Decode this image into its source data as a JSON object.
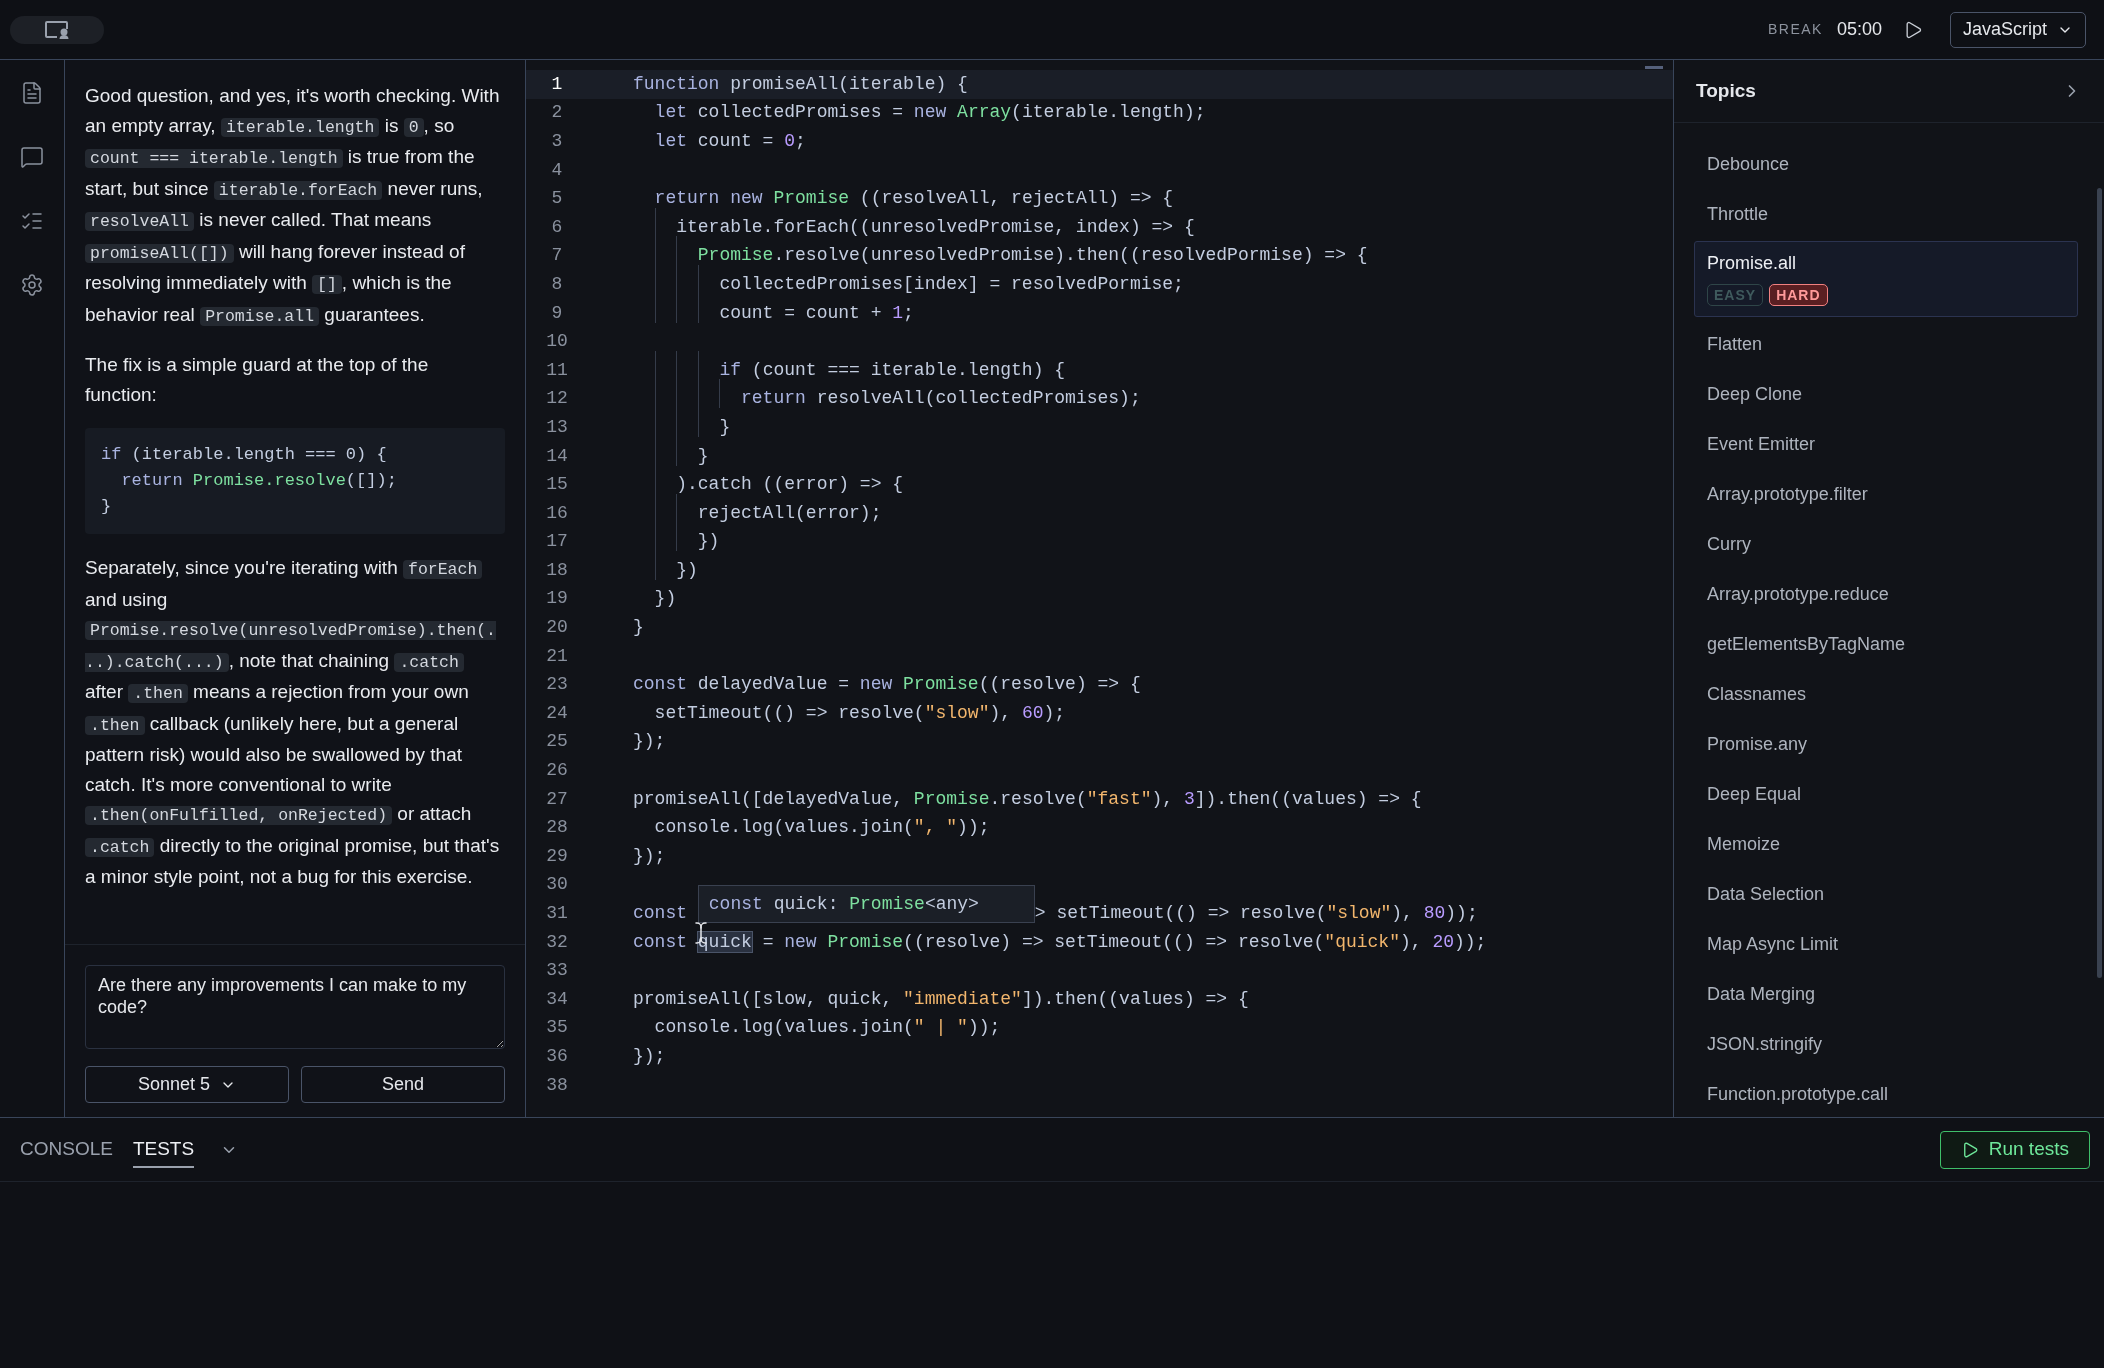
{
  "top_bar": {
    "break_label": "BREAK",
    "timer": "05:00",
    "language": "JavaScript"
  },
  "rail": [
    {
      "kind": "document"
    },
    {
      "kind": "chat"
    },
    {
      "kind": "checklist"
    },
    {
      "kind": "settings"
    }
  ],
  "chat": {
    "blocks": [
      {
        "kind": "paragraph",
        "segments": [
          {
            "kind": "text",
            "text": "Good question, and yes, it's worth checking. With an empty array, "
          },
          {
            "kind": "code",
            "text": "iterable.length"
          },
          {
            "kind": "text",
            "text": " is "
          },
          {
            "kind": "code",
            "text": "0"
          },
          {
            "kind": "text",
            "text": ", so "
          },
          {
            "kind": "code",
            "text": "count === iterable.length"
          },
          {
            "kind": "text",
            "text": " is true from the start, but since "
          },
          {
            "kind": "code",
            "text": "iterable.forEach"
          },
          {
            "kind": "text",
            "text": " never runs, "
          },
          {
            "kind": "code",
            "text": "resolveAll"
          },
          {
            "kind": "text",
            "text": " is never called. That means "
          },
          {
            "kind": "code",
            "text": "promiseAll([])"
          },
          {
            "kind": "text",
            "text": " will hang forever instead of resolving immediately with "
          },
          {
            "kind": "code",
            "text": "[]"
          },
          {
            "kind": "text",
            "text": ", which is the behavior real "
          },
          {
            "kind": "code",
            "text": "Promise.all"
          },
          {
            "kind": "text",
            "text": " guarantees."
          }
        ]
      },
      {
        "kind": "paragraph",
        "segments": [
          {
            "kind": "text",
            "text": "The fix is a simple guard at the top of the function:"
          }
        ]
      },
      {
        "kind": "code_block",
        "lines": [
          [
            {
              "kind": "k",
              "text": "if "
            },
            {
              "kind": "v",
              "text": "(iterable.length === 0) {"
            }
          ],
          [
            {
              "kind": "k",
              "text": "  return "
            },
            {
              "kind": "c",
              "text": "Promise.resolve"
            },
            {
              "kind": "v",
              "text": "([]);"
            }
          ],
          [
            {
              "kind": "v",
              "text": "}"
            }
          ]
        ]
      },
      {
        "kind": "paragraph",
        "segments": [
          {
            "kind": "text",
            "text": "Separately, since you're iterating with "
          },
          {
            "kind": "code",
            "text": "forEach"
          },
          {
            "kind": "text",
            "text": " and using "
          },
          {
            "kind": "code",
            "text": "Promise.resolve(unresolvedPromise).then(...).catch(...)"
          },
          {
            "kind": "text",
            "text": ", note that chaining "
          },
          {
            "kind": "code",
            "text": ".catch"
          },
          {
            "kind": "text",
            "text": " after "
          },
          {
            "kind": "code",
            "text": ".then"
          },
          {
            "kind": "text",
            "text": " means a rejection from your own "
          },
          {
            "kind": "code",
            "text": ".then"
          },
          {
            "kind": "text",
            "text": " callback (unlikely here, but a general pattern risk) would also be swallowed by that catch. It's more conventional to write "
          },
          {
            "kind": "code",
            "text": ".then(onFulfilled, onRejected)"
          },
          {
            "kind": "text",
            "text": " or attach "
          },
          {
            "kind": "code",
            "text": ".catch"
          },
          {
            "kind": "text",
            "text": " directly to the original promise, but that's a minor style point, not a bug for this exercise."
          }
        ]
      }
    ],
    "input": {
      "value": "Are there any improvements I can make to my code?"
    },
    "model": "Sonnet 5",
    "send": "Send"
  },
  "editor": {
    "lines": [
      {
        "number": "1",
        "active": true,
        "tokens": [
          {
            "kind": "k",
            "text": "function "
          },
          {
            "kind": "v",
            "text": "promiseAll(iterable) {"
          }
        ]
      },
      {
        "number": "2",
        "active": false,
        "tokens": [
          {
            "kind": "k",
            "text": "  let "
          },
          {
            "kind": "v",
            "text": "collectedPromises = "
          },
          {
            "kind": "k",
            "text": "new "
          },
          {
            "kind": "c",
            "text": "Array"
          },
          {
            "kind": "v",
            "text": "(iterable.length);"
          }
        ]
      },
      {
        "number": "3",
        "active": false,
        "tokens": [
          {
            "kind": "k",
            "text": "  let "
          },
          {
            "kind": "v",
            "text": "count = "
          },
          {
            "kind": "n",
            "text": "0"
          },
          {
            "kind": "v",
            "text": ";"
          }
        ]
      },
      {
        "number": "4",
        "active": false
      },
      {
        "number": "5",
        "active": false,
        "tokens": [
          {
            "kind": "k",
            "text": "  return new "
          },
          {
            "kind": "c",
            "text": "Promise"
          },
          {
            "kind": "v",
            "text": " ((resolveAll, rejectAll) => {"
          }
        ]
      },
      {
        "number": "6",
        "active": false,
        "tokens": [
          {
            "kind": "v",
            "text": "    iterable.forEach((unresolvedPromise, index) => {"
          }
        ]
      },
      {
        "number": "7",
        "active": false,
        "tokens": [
          {
            "kind": "c",
            "text": "      Promise"
          },
          {
            "kind": "v",
            "text": ".resolve(unresolvedPromise).then((resolvedPormise) => {"
          }
        ]
      },
      {
        "number": "8",
        "active": false,
        "tokens": [
          {
            "kind": "v",
            "text": "        collectedPromises[index] = resolvedPormise;"
          }
        ]
      },
      {
        "number": "9",
        "active": false,
        "tokens": [
          {
            "kind": "v",
            "text": "        count = count + "
          },
          {
            "kind": "n",
            "text": "1"
          },
          {
            "kind": "v",
            "text": ";"
          }
        ]
      },
      {
        "number": "10",
        "active": false
      },
      {
        "number": "11",
        "active": false,
        "tokens": [
          {
            "kind": "k",
            "text": "        if "
          },
          {
            "kind": "v",
            "text": "(count === iterable.length) {"
          }
        ]
      },
      {
        "number": "12",
        "active": false,
        "tokens": [
          {
            "kind": "k",
            "text": "          return "
          },
          {
            "kind": "v",
            "text": "resolveAll(collectedPromises);"
          }
        ]
      },
      {
        "number": "13",
        "active": false,
        "tokens": [
          {
            "kind": "v",
            "text": "        }"
          }
        ]
      },
      {
        "number": "14",
        "active": false,
        "tokens": [
          {
            "kind": "v",
            "text": "      }"
          }
        ]
      },
      {
        "number": "15",
        "active": false,
        "tokens": [
          {
            "kind": "v",
            "text": "    ).catch ((error) => {"
          }
        ]
      },
      {
        "number": "16",
        "active": false,
        "tokens": [
          {
            "kind": "v",
            "text": "      rejectAll(error);"
          }
        ]
      },
      {
        "number": "17",
        "active": false,
        "tokens": [
          {
            "kind": "v",
            "text": "      })"
          }
        ]
      },
      {
        "number": "18",
        "active": false,
        "tokens": [
          {
            "kind": "v",
            "text": "    })"
          }
        ]
      },
      {
        "number": "19",
        "active": false,
        "tokens": [
          {
            "kind": "v",
            "text": "  })"
          }
        ]
      },
      {
        "number": "20",
        "active": false,
        "tokens": [
          {
            "kind": "v",
            "text": "}"
          }
        ]
      },
      {
        "number": "21",
        "active": false
      },
      {
        "number": "23",
        "active": false,
        "tokens": [
          {
            "kind": "k",
            "text": "const "
          },
          {
            "kind": "v",
            "text": "delayedValue = "
          },
          {
            "kind": "k",
            "text": "new "
          },
          {
            "kind": "c",
            "text": "Promise"
          },
          {
            "kind": "v",
            "text": "((resolve) => {"
          }
        ]
      },
      {
        "number": "24",
        "active": false,
        "tokens": [
          {
            "kind": "v",
            "text": "  setTimeout(() => resolve("
          },
          {
            "kind": "s",
            "text": "\"slow\""
          },
          {
            "kind": "v",
            "text": "), "
          },
          {
            "kind": "n",
            "text": "60"
          },
          {
            "kind": "v",
            "text": ");"
          }
        ]
      },
      {
        "number": "25",
        "active": false,
        "tokens": [
          {
            "kind": "v",
            "text": "});"
          }
        ]
      },
      {
        "number": "26",
        "active": false
      },
      {
        "number": "27",
        "active": false,
        "tokens": [
          {
            "kind": "v",
            "text": "promiseAll([delayedValue, "
          },
          {
            "kind": "c",
            "text": "Promise"
          },
          {
            "kind": "v",
            "text": ".resolve("
          },
          {
            "kind": "s",
            "text": "\"fast\""
          },
          {
            "kind": "v",
            "text": "), "
          },
          {
            "kind": "n",
            "text": "3"
          },
          {
            "kind": "v",
            "text": "]).then((values) => {"
          }
        ]
      },
      {
        "number": "28",
        "active": false,
        "tokens": [
          {
            "kind": "v",
            "text": "  console.log(values.join("
          },
          {
            "kind": "s",
            "text": "\", \""
          },
          {
            "kind": "v",
            "text": "));"
          }
        ]
      },
      {
        "number": "29",
        "active": false,
        "tokens": [
          {
            "kind": "v",
            "text": "});"
          }
        ]
      },
      {
        "number": "30",
        "active": false
      },
      {
        "number": "31",
        "active": false,
        "tokens": [
          {
            "kind": "k",
            "text": "const "
          },
          {
            "kind": "tooltip",
            "tokens": [
              {
                "kind": "k",
                "text": "const "
              },
              {
                "kind": "v",
                "text": "quick: "
              },
              {
                "kind": "c",
                "text": "Promise"
              },
              {
                "kind": "v",
                "text": "<any>"
              }
            ]
          },
          {
            "kind": "v",
            "text": "> setTimeout(() => resolve("
          },
          {
            "kind": "s",
            "text": "\"slow\""
          },
          {
            "kind": "v",
            "text": "), "
          },
          {
            "kind": "n",
            "text": "80"
          },
          {
            "kind": "v",
            "text": "));"
          }
        ]
      },
      {
        "number": "32",
        "active": false,
        "cursor": true,
        "tokens": [
          {
            "kind": "k",
            "text": "const "
          },
          {
            "kind": "h",
            "text": "quick"
          },
          {
            "kind": "v",
            "text": " = "
          },
          {
            "kind": "k",
            "text": "new "
          },
          {
            "kind": "c",
            "text": "Promise"
          },
          {
            "kind": "v",
            "text": "((resolve) => setTimeout(() => resolve("
          },
          {
            "kind": "s",
            "text": "\"quick\""
          },
          {
            "kind": "v",
            "text": "), "
          },
          {
            "kind": "n",
            "text": "20"
          },
          {
            "kind": "v",
            "text": "));"
          }
        ]
      },
      {
        "number": "33",
        "active": false
      },
      {
        "number": "34",
        "active": false,
        "tokens": [
          {
            "kind": "v",
            "text": "promiseAll([slow, quick, "
          },
          {
            "kind": "s",
            "text": "\"immediate\""
          },
          {
            "kind": "v",
            "text": "]).then((values) => {"
          }
        ]
      },
      {
        "number": "35",
        "active": false,
        "tokens": [
          {
            "kind": "v",
            "text": "  console.log(values.join("
          },
          {
            "kind": "s",
            "text": "\" | \""
          },
          {
            "kind": "v",
            "text": "));"
          }
        ]
      },
      {
        "number": "36",
        "active": false,
        "tokens": [
          {
            "kind": "v",
            "text": "});"
          }
        ]
      },
      {
        "number": "38",
        "active": false
      }
    ]
  },
  "topics": {
    "title": "Topics",
    "items": [
      {
        "label": "Debounce",
        "selected": false
      },
      {
        "label": "Throttle",
        "selected": false
      },
      {
        "label": "Promise.all",
        "selected": true,
        "tags": [
          {
            "text": "EASY",
            "active": false
          },
          {
            "text": "HARD",
            "active": true
          }
        ]
      },
      {
        "label": "Flatten",
        "selected": false
      },
      {
        "label": "Deep Clone",
        "selected": false
      },
      {
        "label": "Event Emitter",
        "selected": false
      },
      {
        "label": "Array.prototype.filter",
        "selected": false
      },
      {
        "label": "Curry",
        "selected": false
      },
      {
        "label": "Array.prototype.reduce",
        "selected": false
      },
      {
        "label": "getElementsByTagName",
        "selected": false
      },
      {
        "label": "Classnames",
        "selected": false
      },
      {
        "label": "Promise.any",
        "selected": false
      },
      {
        "label": "Deep Equal",
        "selected": false
      },
      {
        "label": "Memoize",
        "selected": false
      },
      {
        "label": "Data Selection",
        "selected": false
      },
      {
        "label": "Map Async Limit",
        "selected": false
      },
      {
        "label": "Data Merging",
        "selected": false
      },
      {
        "label": "JSON.stringify",
        "selected": false
      },
      {
        "label": "Function.prototype.call",
        "selected": false
      }
    ]
  },
  "bottom": {
    "tabs": [
      {
        "label": "CONSOLE",
        "selected": false
      },
      {
        "label": "TESTS",
        "selected": true
      }
    ],
    "run_button": "Run tests"
  }
}
